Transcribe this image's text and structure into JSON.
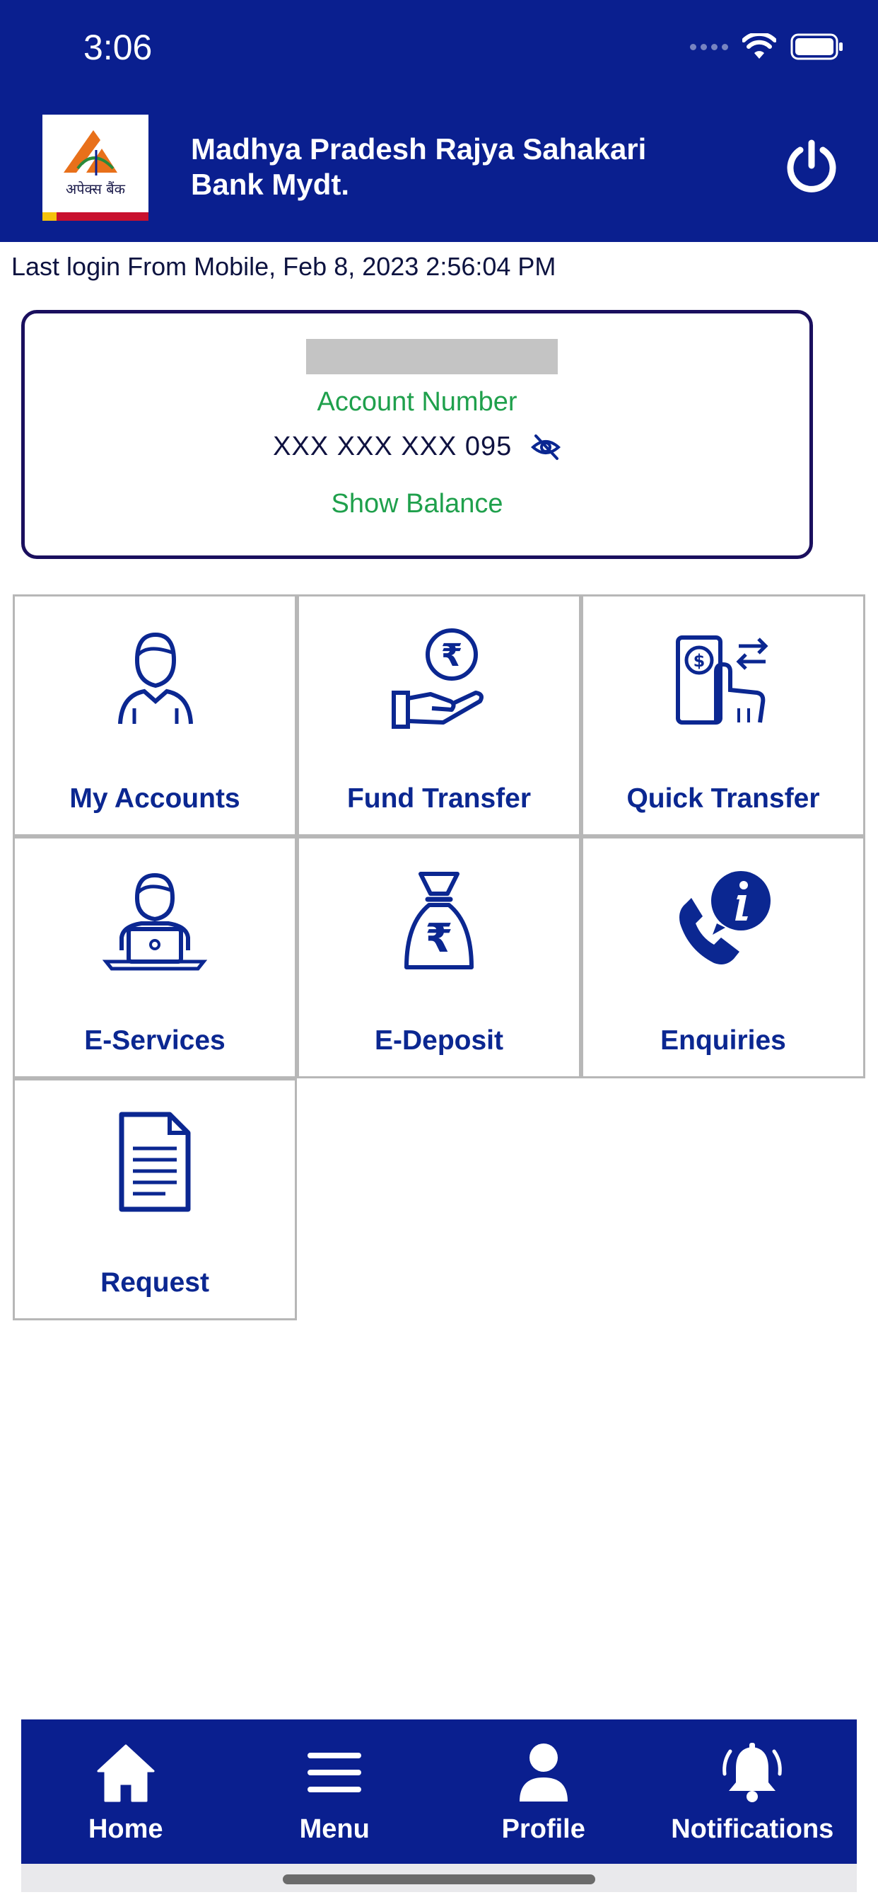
{
  "status_bar": {
    "time": "3:06",
    "icons": [
      "signal-dots-icon",
      "wifi-icon",
      "battery-icon"
    ]
  },
  "header": {
    "logo_text": "अपेक्स बैंक",
    "bank_name_line1": "Madhya Pradesh Rajya Sahakari",
    "bank_name_line2": "Bank Mydt.",
    "logout_icon": "power-icon"
  },
  "last_login": "Last login From Mobile, Feb 8, 2023 2:56:04 PM",
  "account_card": {
    "account_label": "Account Number",
    "account_number": "XXX XXX XXX 095",
    "visibility_icon": "eye-off-icon",
    "show_balance": "Show Balance"
  },
  "tiles": [
    {
      "label": "My Accounts",
      "icon": "user-icon"
    },
    {
      "label": "Fund Transfer",
      "icon": "rupee-hand-icon"
    },
    {
      "label": "Quick Transfer",
      "icon": "quick-transfer-icon"
    },
    {
      "label": "E-Services",
      "icon": "laptop-user-icon"
    },
    {
      "label": "E-Deposit",
      "icon": "money-bag-icon"
    },
    {
      "label": "Enquiries",
      "icon": "phone-info-icon"
    },
    {
      "label": "Request",
      "icon": "document-icon"
    }
  ],
  "bottom_nav": [
    {
      "label": "Home",
      "icon": "home-icon"
    },
    {
      "label": "Menu",
      "icon": "menu-icon"
    },
    {
      "label": "Profile",
      "icon": "profile-icon"
    },
    {
      "label": "Notifications",
      "icon": "bell-icon"
    }
  ],
  "colors": {
    "primary": "#0a1f8f",
    "accent_green": "#1fa04c",
    "tile_text": "#0b2791",
    "card_border": "#1a0f5e"
  }
}
